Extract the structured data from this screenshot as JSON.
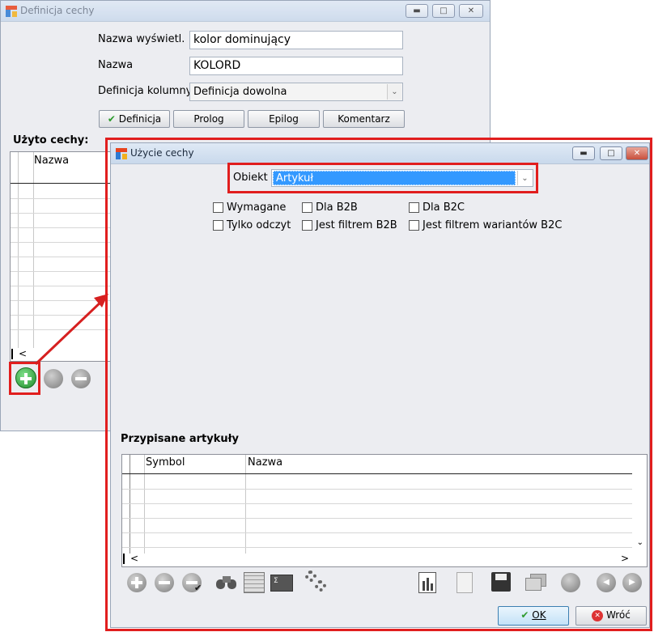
{
  "back_window": {
    "title": "Definicja cechy",
    "fields": {
      "display_name_label": "Nazwa wyświetl.",
      "display_name_value": "kolor dominujący",
      "name_label": "Nazwa",
      "name_value": "KOLORD",
      "column_def_label": "Definicja kolumny",
      "column_def_value": "Definicja dowolna"
    },
    "buttons": {
      "definicja": "Definicja",
      "prolog": "Prolog",
      "epilog": "Epilog",
      "komentarz": "Komentarz"
    },
    "used_label": "Użyto cechy:",
    "grid_header_name": "Nazwa",
    "scroll_left": "<"
  },
  "front_window": {
    "title": "Użycie cechy",
    "object_label": "Obiekt",
    "object_value": "Artykuł",
    "checkboxes": {
      "wymagane": "Wymagane",
      "dla_b2b": "Dla B2B",
      "dla_b2c": "Dla B2C",
      "tylko_odczyt": "Tylko odczyt",
      "filtrem_b2b": "Jest filtrem B2B",
      "filtrem_b2c": "Jest filtrem wariantów B2C"
    },
    "assigned_label": "Przypisane artykuły",
    "grid_headers": {
      "symbol": "Symbol",
      "name": "Nazwa"
    },
    "scroll_left": "<",
    "scroll_right": ">",
    "buttons": {
      "ok": "OK",
      "back": "Wróć"
    }
  },
  "colors": {
    "highlight_frame": "#e11e1e",
    "selection": "#3399ff",
    "add_icon": "#2fa83b"
  },
  "icons": [
    "app-icon",
    "minimize-icon",
    "maximize-icon",
    "close-icon",
    "checkmark-icon",
    "add-icon",
    "edit-icon",
    "remove-icon",
    "binoculars-icon",
    "grid-icon",
    "calculator-icon",
    "gears-icon",
    "report-icon",
    "document-icon",
    "save-icon",
    "copy-icon",
    "refresh-icon",
    "first-icon",
    "last-icon",
    "ok-check-icon",
    "cancel-icon"
  ]
}
